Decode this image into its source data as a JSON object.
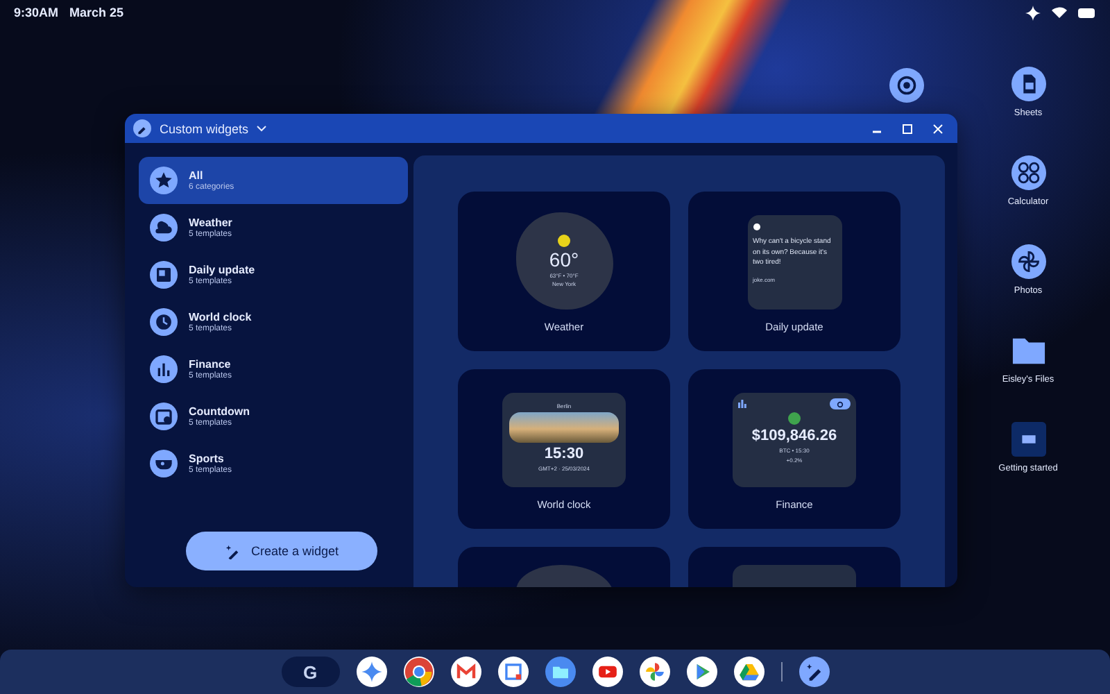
{
  "status_bar": {
    "time": "9:30AM",
    "date": "March 25"
  },
  "window": {
    "title": "Custom widgets"
  },
  "categories": [
    {
      "name": "All",
      "count": "6 categories",
      "kind": "star",
      "selected": true
    },
    {
      "name": "Weather",
      "count": "5 templates",
      "kind": "weather",
      "selected": false
    },
    {
      "name": "Daily update",
      "count": "5 templates",
      "kind": "news",
      "selected": false
    },
    {
      "name": "World clock",
      "count": "5 templates",
      "kind": "clock",
      "selected": false
    },
    {
      "name": "Finance",
      "count": "5 templates",
      "kind": "chart",
      "selected": false
    },
    {
      "name": "Countdown",
      "count": "5 templates",
      "kind": "calendar",
      "selected": false
    },
    {
      "name": "Sports",
      "count": "5 templates",
      "kind": "whistle",
      "selected": false
    }
  ],
  "create_button": "Create a widget",
  "widgets": [
    {
      "kind": "weather",
      "label": "Weather",
      "temp": "60°",
      "range": "63°F • 70°F",
      "city": "New York"
    },
    {
      "kind": "daily",
      "label": "Daily update",
      "text": "Why can't a bicycle stand on its own? Because it's two tired!",
      "source": "joke.com"
    },
    {
      "kind": "clock",
      "label": "World clock",
      "city": "Berlin",
      "time": "15:30",
      "zone": "GMT+2 · 25/03/2024"
    },
    {
      "kind": "finance",
      "label": "Finance",
      "price": "$109,846.26",
      "ticker": "BTC • 15:30",
      "change": "+0.2%"
    },
    {
      "kind": "blob"
    },
    {
      "kind": "panel"
    }
  ],
  "desktop_icons": [
    {
      "kind": "sheets",
      "label": "Sheets"
    },
    {
      "kind": "calculator",
      "label": "Calculator"
    },
    {
      "kind": "photos",
      "label": "Photos"
    },
    {
      "kind": "folder",
      "label": "Eisley's Files"
    },
    {
      "kind": "pdf",
      "label": "Getting started"
    }
  ],
  "shelf": {
    "launcher": "G",
    "apps": [
      {
        "kind": "gemini"
      },
      {
        "kind": "chrome"
      },
      {
        "kind": "gmail"
      },
      {
        "kind": "calendar"
      },
      {
        "kind": "files"
      },
      {
        "kind": "youtube"
      },
      {
        "kind": "photos"
      },
      {
        "kind": "play"
      },
      {
        "kind": "drive"
      }
    ],
    "pinned": {
      "kind": "widget"
    }
  }
}
